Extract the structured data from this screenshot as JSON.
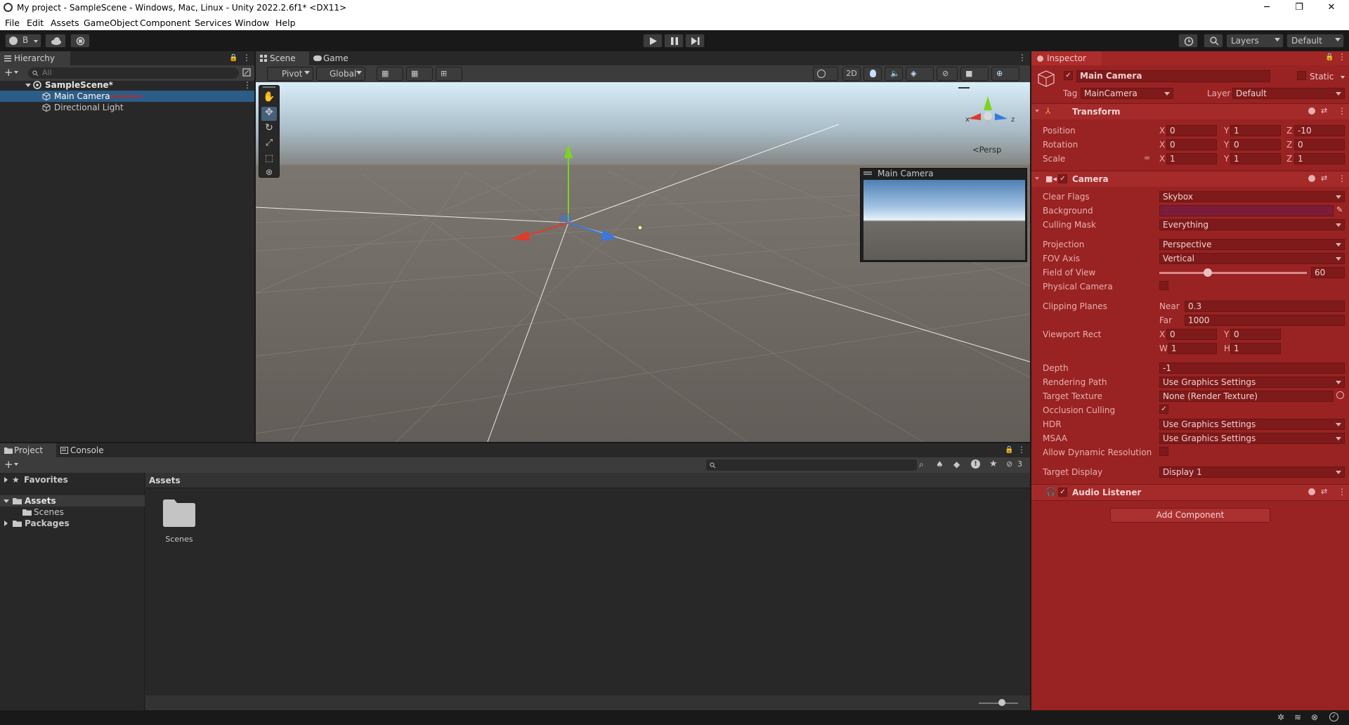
{
  "window": {
    "title": "My project - SampleScene - Windows, Mac, Linux - Unity 2022.2.6f1* <DX11>",
    "minimize": "─",
    "maximize": "❐",
    "close": "✕"
  },
  "menu": [
    "File",
    "Edit",
    "Assets",
    "GameObject",
    "Component",
    "Services",
    "Window",
    "Help"
  ],
  "toolbar": {
    "account": "B",
    "layers": "Layers",
    "layout": "Default"
  },
  "hierarchy": {
    "tab": "Hierarchy",
    "search_placeholder": "All",
    "scene": "SampleScene*",
    "items": [
      "Main Camera",
      "Directional Light"
    ]
  },
  "scene_view": {
    "tabs": [
      "Scene",
      "Game"
    ],
    "pivot": "Pivot",
    "global": "Global",
    "mode_2d": "2D",
    "persp": "<Persp",
    "camera_preview_title": "Main Camera",
    "gizmo_axes": {
      "x": "x",
      "z": "z"
    }
  },
  "project": {
    "tabs": [
      "Project",
      "Console"
    ],
    "tree": {
      "favorites": "Favorites",
      "assets": "Assets",
      "scenes": "Scenes",
      "packages": "Packages"
    },
    "breadcrumb": "Assets",
    "grid_items": [
      "Scenes"
    ],
    "hidden_count": "3"
  },
  "inspector": {
    "tab": "Inspector",
    "object_name": "Main Camera",
    "static_label": "Static",
    "tag_label": "Tag",
    "tag_value": "MainCamera",
    "layer_label": "Layer",
    "layer_value": "Default",
    "transform": {
      "title": "Transform",
      "position": {
        "label": "Position",
        "x": "0",
        "y": "1",
        "z": "-10"
      },
      "rotation": {
        "label": "Rotation",
        "x": "0",
        "y": "0",
        "z": "0"
      },
      "scale": {
        "label": "Scale",
        "x": "1",
        "y": "1",
        "z": "1"
      }
    },
    "camera": {
      "title": "Camera",
      "clear_flags": {
        "label": "Clear Flags",
        "value": "Skybox"
      },
      "background": {
        "label": "Background",
        "color": "#7a1c3a"
      },
      "culling_mask": {
        "label": "Culling Mask",
        "value": "Everything"
      },
      "projection": {
        "label": "Projection",
        "value": "Perspective"
      },
      "fov_axis": {
        "label": "FOV Axis",
        "value": "Vertical"
      },
      "field_of_view": {
        "label": "Field of View",
        "value": "60",
        "fraction": 0.33
      },
      "physical_camera": {
        "label": "Physical Camera"
      },
      "clipping_planes": {
        "label": "Clipping Planes",
        "near_label": "Near",
        "near": "0.3",
        "far_label": "Far",
        "far": "1000"
      },
      "viewport_rect": {
        "label": "Viewport Rect",
        "x": "0",
        "y": "0",
        "w": "1",
        "h": "1"
      },
      "depth": {
        "label": "Depth",
        "value": "-1"
      },
      "rendering_path": {
        "label": "Rendering Path",
        "value": "Use Graphics Settings"
      },
      "target_texture": {
        "label": "Target Texture",
        "value": "None (Render Texture)"
      },
      "occlusion_culling": {
        "label": "Occlusion Culling"
      },
      "hdr": {
        "label": "HDR",
        "value": "Use Graphics Settings"
      },
      "msaa": {
        "label": "MSAA",
        "value": "Use Graphics Settings"
      },
      "dynamic_resolution": {
        "label": "Allow Dynamic Resolution"
      },
      "target_display": {
        "label": "Target Display",
        "value": "Display 1"
      }
    },
    "audio_listener": {
      "title": "Audio Listener"
    },
    "add_component": "Add Component"
  }
}
